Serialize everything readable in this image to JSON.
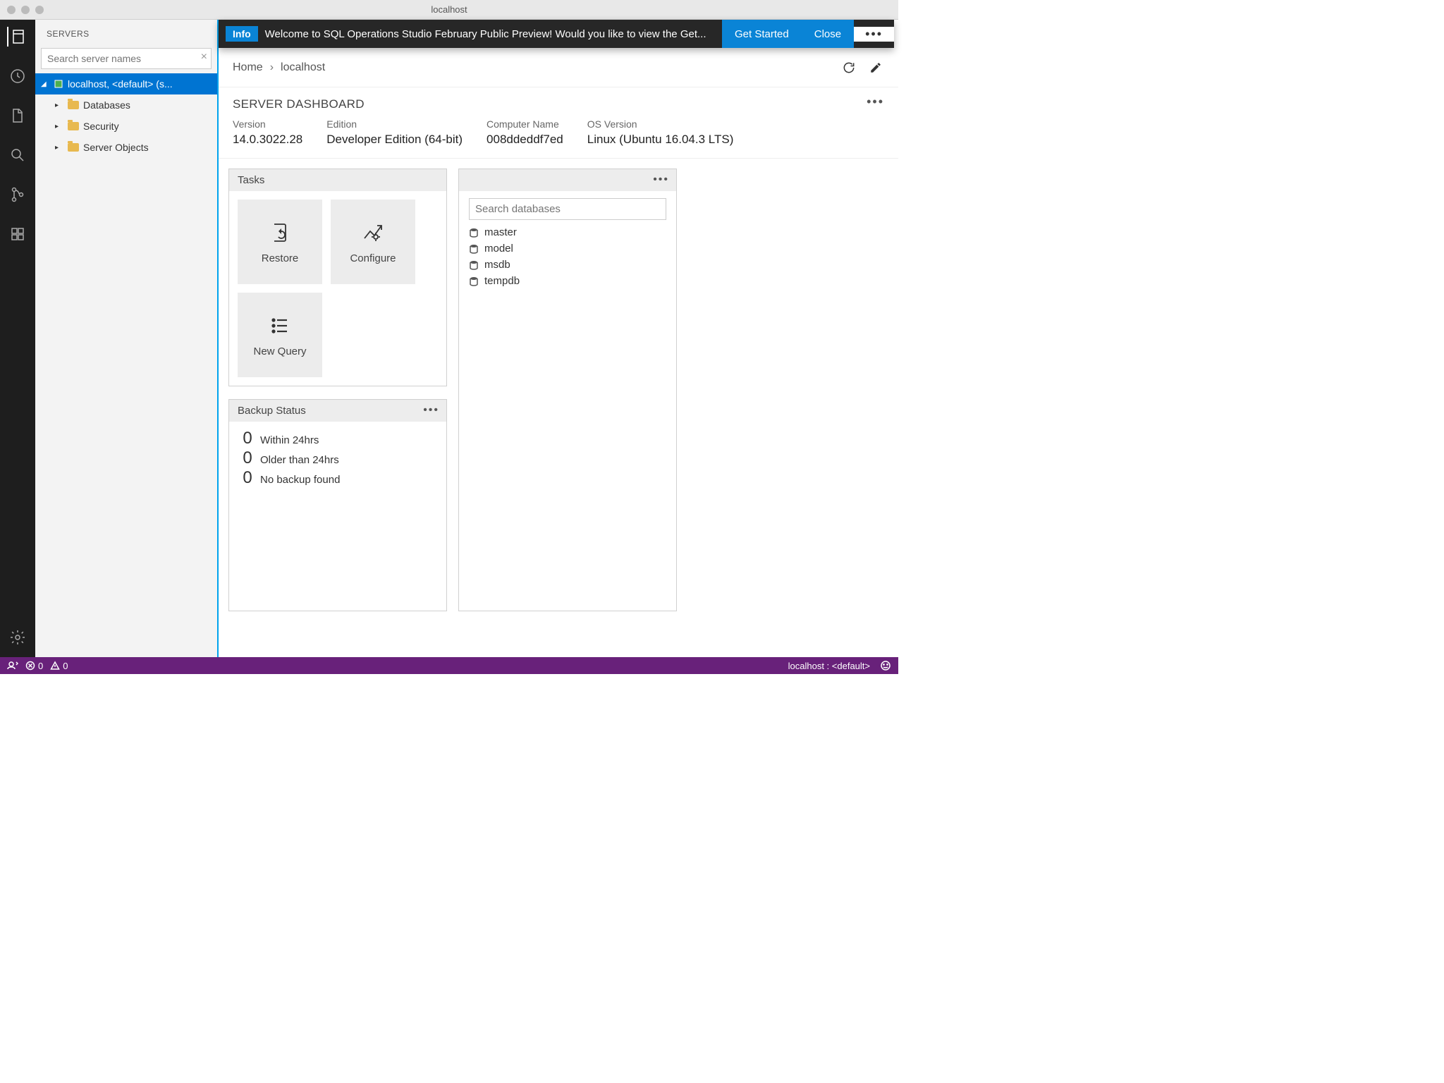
{
  "window": {
    "title": "localhost"
  },
  "sidebar": {
    "title": "SERVERS",
    "search_placeholder": "Search server names",
    "root": "localhost, <default> (s...",
    "items": [
      "Databases",
      "Security",
      "Server Objects"
    ]
  },
  "banner": {
    "tag": "Info",
    "message": "Welcome to SQL Operations Studio February Public Preview! Would you like to view the Get...",
    "get_started": "Get Started",
    "close": "Close"
  },
  "breadcrumb": {
    "home": "Home",
    "current": "localhost"
  },
  "dashboard": {
    "title": "SERVER DASHBOARD",
    "props": [
      {
        "label": "Version",
        "value": "14.0.3022.28"
      },
      {
        "label": "Edition",
        "value": "Developer Edition (64-bit)"
      },
      {
        "label": "Computer Name",
        "value": "008ddeddf7ed"
      },
      {
        "label": "OS Version",
        "value": "Linux (Ubuntu 16.04.3 LTS)"
      }
    ]
  },
  "tasks": {
    "title": "Tasks",
    "tiles": [
      "Restore",
      "Configure",
      "New Query"
    ]
  },
  "databases": {
    "search_placeholder": "Search databases",
    "items": [
      "master",
      "model",
      "msdb",
      "tempdb"
    ]
  },
  "backup": {
    "title": "Backup Status",
    "rows": [
      {
        "count": "0",
        "label": "Within 24hrs"
      },
      {
        "count": "0",
        "label": "Older than 24hrs"
      },
      {
        "count": "0",
        "label": "No backup found"
      }
    ]
  },
  "statusbar": {
    "errors": "0",
    "warnings": "0",
    "connection": "localhost : <default>"
  }
}
